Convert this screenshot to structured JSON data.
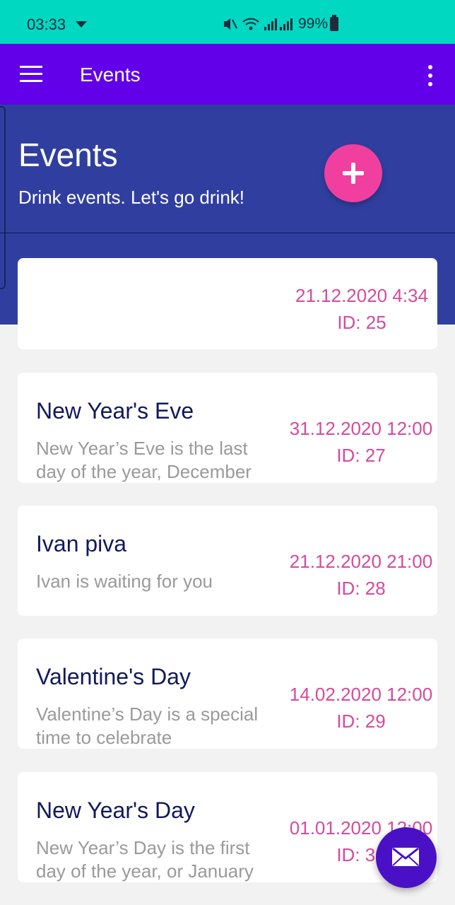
{
  "status_bar": {
    "time": "03:33",
    "battery": "99%"
  },
  "app_bar": {
    "title": "Events"
  },
  "header": {
    "title": "Events",
    "subtitle": "Drink events. Let's go drink!"
  },
  "events": [
    {
      "title": "",
      "description": "",
      "date": "21.12.2020 4:34",
      "id_label": "ID: 25"
    },
    {
      "title": "New Year's Eve",
      "description": "New Year’s Eve is the last day of the year, December",
      "date": "31.12.2020 12:00",
      "id_label": "ID: 27"
    },
    {
      "title": "Ivan piva",
      "description": "Ivan is waiting for you",
      "date": "21.12.2020 21:00",
      "id_label": "ID: 28"
    },
    {
      "title": "Valentine's Day",
      "description": "Valentine’s Day is a special time to celebrate",
      "date": "14.02.2020 12:00",
      "id_label": "ID: 29"
    },
    {
      "title": "New Year's Day",
      "description": "New Year’s Day is the first day of the year, or January",
      "date": "01.01.2020 12:00",
      "id_label": "ID: 30"
    }
  ],
  "colors": {
    "status_bar": "#00d8c2",
    "app_bar": "#6200ea",
    "header": "#303f9f",
    "accent": "#f13f9f",
    "date_text": "#d64a9c",
    "fab": "#4a10c6"
  },
  "icons": [
    "menu-icon",
    "more-vert-icon",
    "plus-icon",
    "mail-icon",
    "wifi-icon",
    "signal-icon",
    "battery-icon",
    "mute-icon"
  ]
}
